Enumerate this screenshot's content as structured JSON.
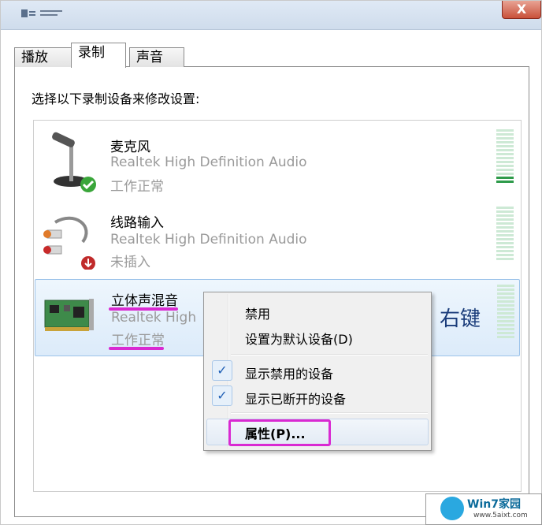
{
  "window": {
    "close_label": "X"
  },
  "tabs": [
    {
      "label": "播放"
    },
    {
      "label": "录制"
    },
    {
      "label": "声音"
    }
  ],
  "instruction": "选择以下录制设备来修改设置:",
  "devices": [
    {
      "name": "麦克风",
      "driver": "Realtek High Definition Audio",
      "status": "工作正常",
      "icon": "microphone-icon",
      "badge": "check-badge-icon",
      "meter_level": 0.15
    },
    {
      "name": "线路输入",
      "driver": "Realtek High Definition Audio",
      "status": "未插入",
      "icon": "line-in-cable-icon",
      "badge": "down-arrow-badge-icon",
      "meter_level": 0
    },
    {
      "name": "立体声混音",
      "driver": "Realtek High",
      "status": "工作正常",
      "icon": "sound-card-icon",
      "meter_level": 0
    }
  ],
  "annotation": "右键",
  "context_menu": {
    "items": [
      {
        "label": "禁用",
        "checked": false
      },
      {
        "label": "设置为默认设备(D)",
        "checked": false
      },
      {
        "label": "显示禁用的设备",
        "checked": true
      },
      {
        "label": "显示已断开的设备",
        "checked": true
      },
      {
        "label": "属性(P)...",
        "checked": false,
        "highlighted": true
      }
    ]
  },
  "watermark": {
    "title": "Win7家园",
    "url": "www.5aixt.com"
  },
  "colors": {
    "highlight_annotation": "#d92ad2",
    "selection": "#dcebfa",
    "meter_lit": "#2e9b4a"
  }
}
